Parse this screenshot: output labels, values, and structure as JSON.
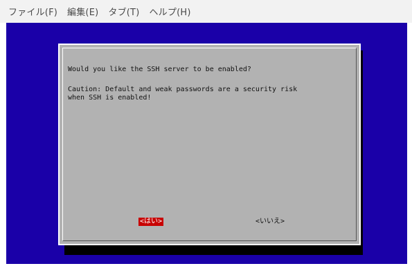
{
  "menubar": {
    "items": [
      "ファイル(F)",
      "編集(E)",
      "タブ(T)",
      "ヘルプ(H)"
    ]
  },
  "dialog": {
    "question": "Would you like the SSH server to be enabled?",
    "caution_line1": "Caution: Default and weak passwords are a security risk",
    "caution_line2": "when SSH is enabled!",
    "yes_label": "<はい>",
    "no_label": "<いいえ>"
  },
  "colors": {
    "terminal_background": "#1a00a8",
    "dialog_background": "#b2b2b2",
    "selected_button": "#c80000"
  }
}
